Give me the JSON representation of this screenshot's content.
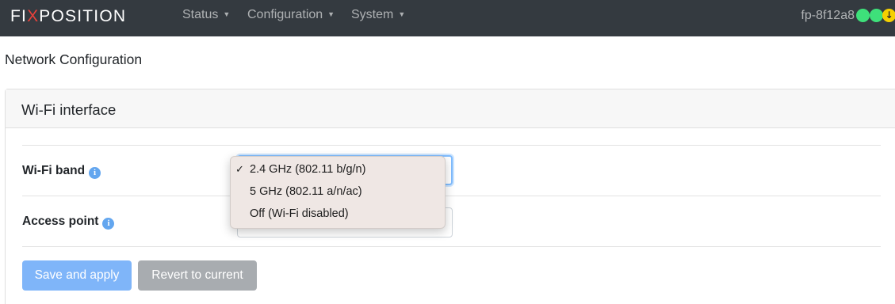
{
  "navbar": {
    "brand_prefix": "FI",
    "brand_x": "X",
    "brand_suffix": "POSITION",
    "menu": [
      {
        "label": "Status"
      },
      {
        "label": "Configuration"
      },
      {
        "label": "System"
      }
    ],
    "hostname": "fp-8f12a8",
    "status_indicators": [
      {
        "icon": "status-ok-icon",
        "color": "#3ee07a"
      },
      {
        "icon": "status-ok-icon",
        "color": "#3ee07a"
      },
      {
        "icon": "update-available-icon",
        "color": "#f5d000",
        "glyph": "↓"
      }
    ]
  },
  "page": {
    "title": "Network Configuration"
  },
  "card": {
    "header": "Wi-Fi interface",
    "fields": [
      {
        "label": "Wi-Fi band",
        "info_icon": "info-icon"
      },
      {
        "label": "Access point",
        "info_icon": "info-icon"
      }
    ],
    "buttons": {
      "save": "Save and apply",
      "revert": "Revert to current"
    }
  },
  "dropdown": {
    "options": [
      {
        "label": "2.4 GHz (802.11 b/g/n)",
        "selected": true
      },
      {
        "label": "5 GHz (802.11 a/n/ac)",
        "selected": false
      },
      {
        "label": "Off (Wi-Fi disabled)",
        "selected": false
      }
    ],
    "check_glyph": "✓"
  },
  "colors": {
    "navbar": "#343a40",
    "brand_accent": "#e8413a",
    "primary": "#7fb5f9",
    "secondary": "#a8acb0",
    "info": "#63a6ef"
  }
}
